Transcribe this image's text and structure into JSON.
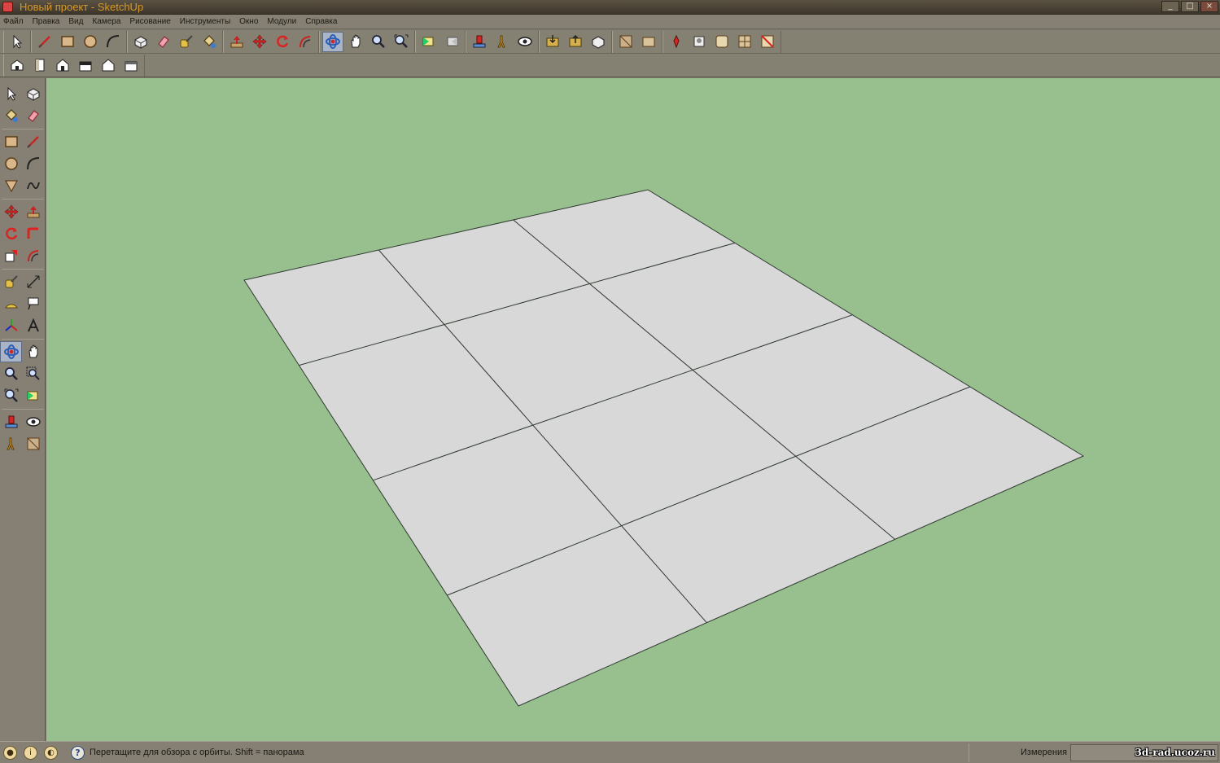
{
  "window": {
    "title": "Новый проект - SketchUp",
    "buttons": [
      "_",
      "□",
      "×"
    ]
  },
  "menu": [
    "Файл",
    "Правка",
    "Вид",
    "Камера",
    "Рисование",
    "Инструменты",
    "Окно",
    "Модули",
    "Справка"
  ],
  "toolbar_main": {
    "groups": [
      [
        "select-icon"
      ],
      [
        "line-icon",
        "rectangle-icon",
        "circle-icon",
        "arc-icon"
      ],
      [
        "make-component-icon",
        "eraser-icon",
        "tape-measure-icon",
        "paint-bucket-icon"
      ],
      [
        "push-pull-icon",
        "move-icon",
        "rotate-icon",
        "offset-icon"
      ],
      [
        "orbit-icon",
        "pan-icon",
        "zoom-icon",
        "zoom-extents-icon"
      ],
      [
        "previous-view-icon",
        "next-view-icon"
      ],
      [
        "position-camera-icon",
        "walk-icon",
        "look-around-icon"
      ],
      [
        "get-models-icon",
        "share-model-icon",
        "share-component-icon"
      ],
      [
        "section-plane-icon",
        "section-display-icon"
      ],
      [
        "sandbox-from-contours-icon",
        "sandbox-stamp-icon",
        "sandbox-drape-icon",
        "sandbox-smoove-icon",
        "sandbox-flip-edge-icon"
      ]
    ],
    "active": "orbit-icon"
  },
  "toolbar_views": [
    "iso-view-icon",
    "top-view-icon",
    "front-view-icon",
    "right-view-icon",
    "back-view-icon",
    "left-view-icon"
  ],
  "palette": [
    [
      "select-icon",
      "make-component-icon"
    ],
    [
      "paint-bucket-icon",
      "eraser-icon"
    ],
    [
      "rectangle-icon",
      "line-icon"
    ],
    [
      "circle-icon",
      "arc-icon"
    ],
    [
      "polygon-icon",
      "freehand-icon"
    ],
    [
      "move-icon",
      "push-pull-icon"
    ],
    [
      "rotate-icon",
      "follow-me-icon"
    ],
    [
      "scale-icon",
      "offset-icon"
    ],
    [
      "tape-measure-icon",
      "dimension-icon"
    ],
    [
      "protractor-icon",
      "text-icon"
    ],
    [
      "axes-icon",
      "3d-text-icon"
    ],
    [
      "orbit-icon",
      "pan-icon"
    ],
    [
      "zoom-icon",
      "zoom-window-icon"
    ],
    [
      "zoom-extents-icon",
      "previous-view-icon"
    ],
    [
      "position-camera-icon",
      "look-around-icon"
    ],
    [
      "walk-icon",
      "section-plane-icon"
    ]
  ],
  "palette_active": "orbit-icon",
  "scene": {
    "background": "#98bf8e",
    "face_color": "#d8d8d8",
    "edge_color": "#2f3a30",
    "grid": {
      "columns": 3,
      "rows": 4
    }
  },
  "statusbar": {
    "hint": "Перетащите для обзора с орбиты.  Shift = панорама",
    "help_glyph": "?",
    "measure_label": "Измерения",
    "measure_value": "",
    "watermark": "3d-rad.ucoz.ru"
  },
  "colors": {
    "title_text": "#d89a22",
    "chrome": "#858073",
    "active_tool": "#a9b4c6"
  }
}
